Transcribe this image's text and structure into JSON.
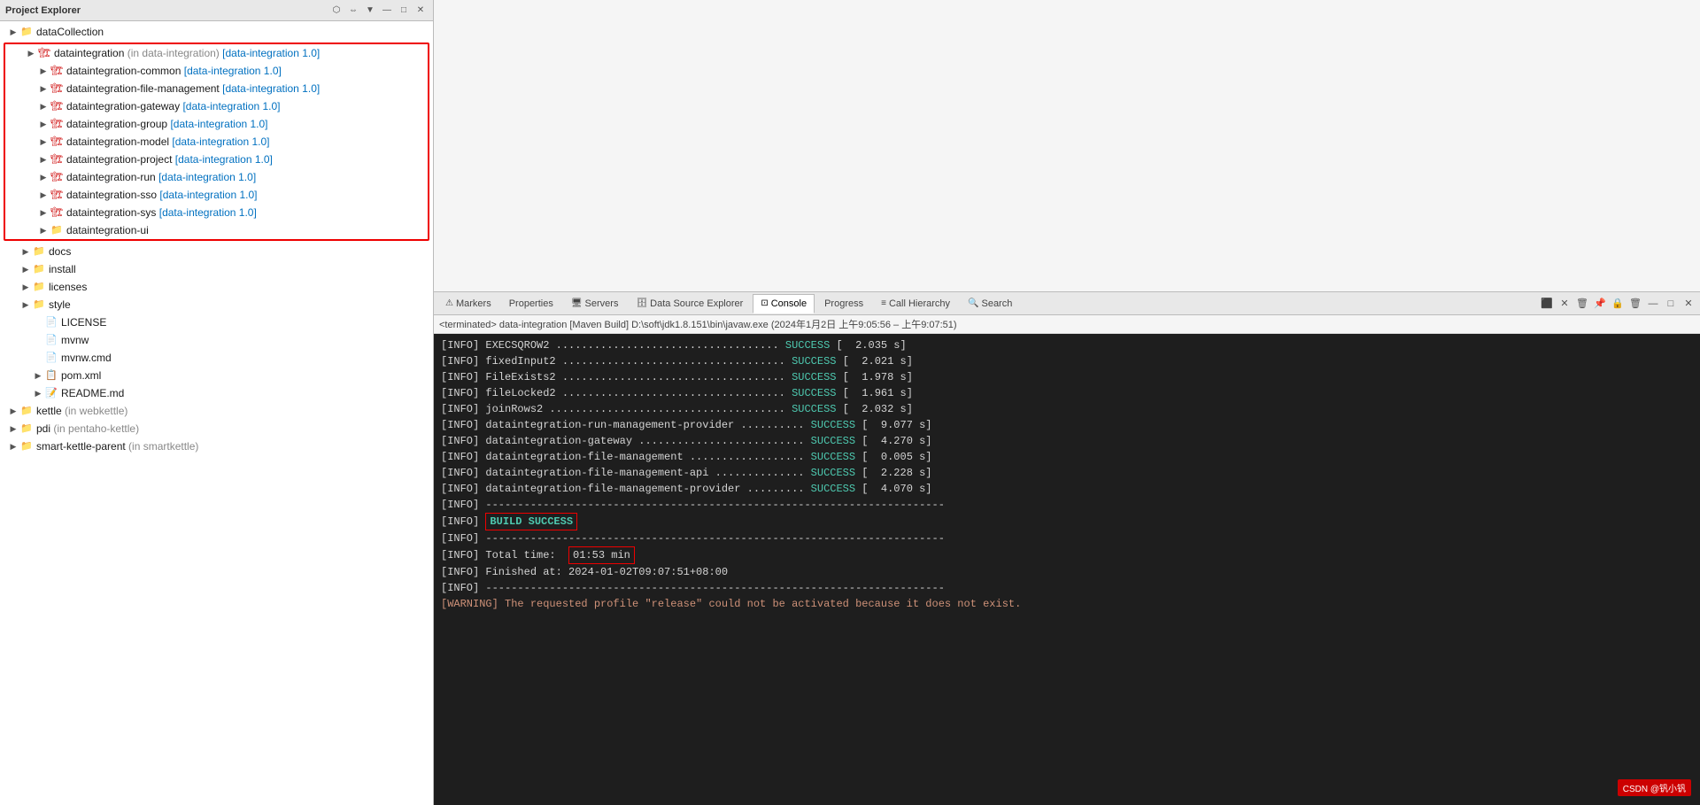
{
  "projectExplorer": {
    "title": "Project Explorer",
    "rootItems": [
      {
        "id": "dataCollection",
        "label": "dataCollection",
        "type": "folder",
        "indent": 0,
        "arrow": "",
        "icon": "folder"
      }
    ],
    "highlightedSection": {
      "items": [
        {
          "id": "dataintegration",
          "label": "dataintegration",
          "suffix": " (in data-integration) [data-integration 1.0]",
          "type": "maven",
          "indent": 1,
          "arrow": "▶",
          "expanded": true
        },
        {
          "id": "dataintegration-common",
          "label": "dataintegration-common",
          "suffix": " [data-integration 1.0]",
          "type": "maven",
          "indent": 2,
          "arrow": "▶"
        },
        {
          "id": "dataintegration-file-management",
          "label": "dataintegration-file-management",
          "suffix": " [data-integration 1.0]",
          "type": "maven",
          "indent": 2,
          "arrow": "▶"
        },
        {
          "id": "dataintegration-gateway",
          "label": "dataintegration-gateway",
          "suffix": " [data-integration 1.0]",
          "type": "maven",
          "indent": 2,
          "arrow": "▶"
        },
        {
          "id": "dataintegration-group",
          "label": "dataintegration-group",
          "suffix": " [data-integration 1.0]",
          "type": "maven",
          "indent": 2,
          "arrow": "▶"
        },
        {
          "id": "dataintegration-model",
          "label": "dataintegration-model",
          "suffix": " [data-integration 1.0]",
          "type": "maven",
          "indent": 2,
          "arrow": "▶"
        },
        {
          "id": "dataintegration-project",
          "label": "dataintegration-project",
          "suffix": " [data-integration 1.0]",
          "type": "maven",
          "indent": 2,
          "arrow": "▶"
        },
        {
          "id": "dataintegration-run",
          "label": "dataintegration-run",
          "suffix": " [data-integration 1.0]",
          "type": "maven",
          "indent": 2,
          "arrow": "▶"
        },
        {
          "id": "dataintegration-sso",
          "label": "dataintegration-sso",
          "suffix": " [data-integration 1.0]",
          "type": "maven",
          "indent": 2,
          "arrow": "▶"
        },
        {
          "id": "dataintegration-sys",
          "label": "dataintegration-sys",
          "suffix": " [data-integration 1.0]",
          "type": "maven",
          "indent": 2,
          "arrow": "▶"
        },
        {
          "id": "dataintegration-ui",
          "label": "dataintegration-ui",
          "suffix": "",
          "type": "folder",
          "indent": 2,
          "arrow": "▶"
        }
      ]
    },
    "otherItems": [
      {
        "id": "docs",
        "label": "docs",
        "type": "folder",
        "indent": 1,
        "arrow": "▶"
      },
      {
        "id": "install",
        "label": "install",
        "type": "folder",
        "indent": 1,
        "arrow": "▶"
      },
      {
        "id": "licenses",
        "label": "licenses",
        "type": "folder",
        "indent": 1,
        "arrow": "▶"
      },
      {
        "id": "style",
        "label": "style",
        "type": "folder",
        "indent": 1,
        "arrow": "▶"
      },
      {
        "id": "LICENSE",
        "label": "LICENSE",
        "type": "file",
        "indent": 2,
        "arrow": ""
      },
      {
        "id": "mvnw",
        "label": "mvnw",
        "type": "file",
        "indent": 2,
        "arrow": ""
      },
      {
        "id": "mvnw.cmd",
        "label": "mvnw.cmd",
        "type": "file",
        "indent": 2,
        "arrow": ""
      },
      {
        "id": "pom.xml",
        "label": "pom.xml",
        "type": "xml",
        "indent": 2,
        "arrow": "▶"
      },
      {
        "id": "README.md",
        "label": "README.md",
        "type": "md",
        "indent": 2,
        "arrow": "▶"
      },
      {
        "id": "kettle",
        "label": "kettle",
        "suffix": " (in webkettle)",
        "type": "folder",
        "indent": 0,
        "arrow": "▶"
      },
      {
        "id": "pdi",
        "label": "pdi",
        "suffix": " (in pentaho-kettle)",
        "type": "folder",
        "indent": 0,
        "arrow": "▶"
      },
      {
        "id": "smart-kettle-parent",
        "label": "smart-kettle-parent",
        "suffix": " (in smartkettle)",
        "type": "folder",
        "indent": 0,
        "arrow": "▶"
      }
    ]
  },
  "consoleTabs": {
    "markers": "Markers",
    "properties": "Properties",
    "servers": "Servers",
    "datasource": "Data Source Explorer",
    "console": "Console",
    "progress": "Progress",
    "callhierarchy": "Call Hierarchy",
    "search": "Search"
  },
  "consoleStatus": "<terminated> data-integration [Maven Build] D:\\soft\\jdk1.8.151\\bin\\javaw.exe  (2024年1月2日 上午9:05:56 – 上午9:07:51)",
  "consoleLines": [
    "[INFO] EXECSQROW2 ................................... SUCCESS [  2.035 s]",
    "[INFO] fixedInput2 ................................... SUCCESS [  2.021 s]",
    "[INFO] FileExists2 ................................... SUCCESS [  1.978 s]",
    "[INFO] fileLocked2 ................................... SUCCESS [  1.961 s]",
    "[INFO] joinRows2 ..................................... SUCCESS [  2.032 s]",
    "[INFO] dataintegration-run-management-provider .......... SUCCESS [  9.077 s]",
    "[INFO] dataintegration-gateway .......................... SUCCESS [  4.270 s]",
    "[INFO] dataintegration-file-management .................. SUCCESS [  0.005 s]",
    "[INFO] dataintegration-file-management-api .............. SUCCESS [  2.228 s]",
    "[INFO] dataintegration-file-management-provider ......... SUCCESS [  4.070 s]",
    "[INFO] ------------------------------------------------------------------------",
    "[INFO] BUILD SUCCESS",
    "[INFO] ------------------------------------------------------------------------",
    "[INFO] Total time:  01:53 min",
    "[INFO] Finished at: 2024-01-02T09:07:51+08:00",
    "[INFO] ------------------------------------------------------------------------",
    "[WARNING] The requested profile \"release\" could not be activated because it does not exist."
  ],
  "buildSuccess": "BUILD SUCCESS",
  "totalTime": "01:53 min",
  "csdn": "CSDN @钒小钒"
}
